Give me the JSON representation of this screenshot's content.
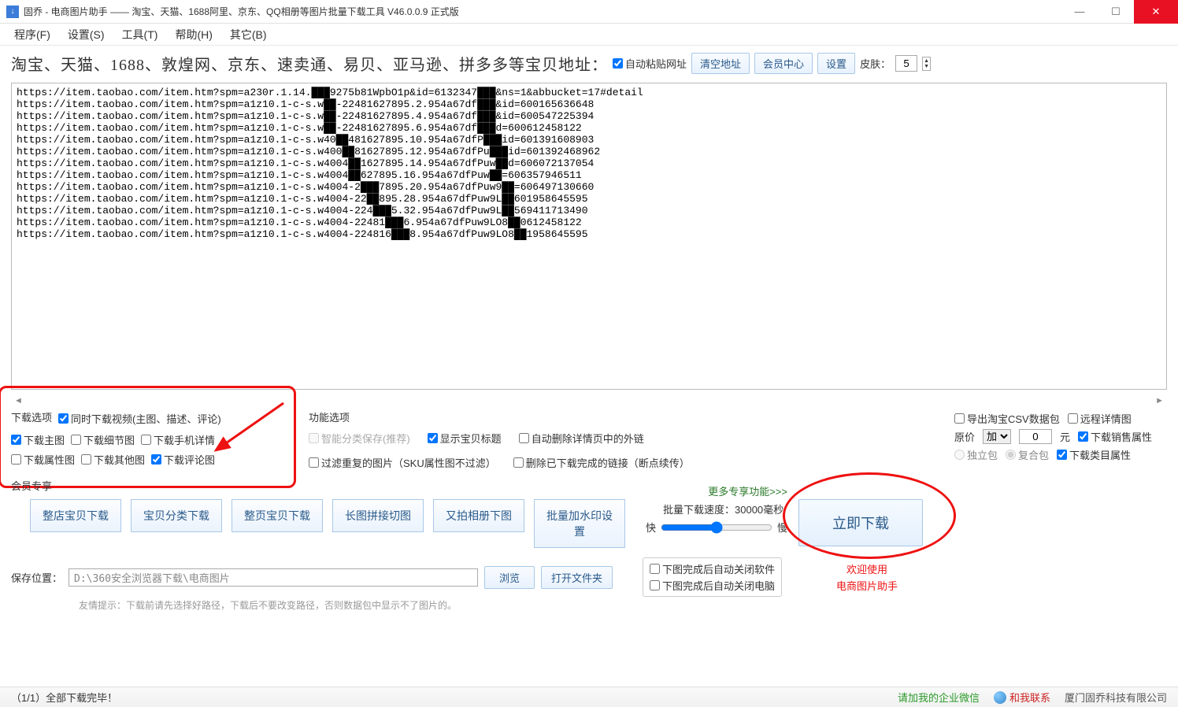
{
  "title": "固乔 - 电商图片助手 —— 淘宝、天猫、1688阿里、京东、QQ相册等图片批量下载工具 V46.0.0.9 正式版",
  "menu": {
    "program": "程序(F)",
    "settings": "设置(S)",
    "tools": "工具(T)",
    "help": "帮助(H)",
    "other": "其它(B)"
  },
  "topbar": {
    "label": "淘宝、天猫、1688、敦煌网、京东、速卖通、易贝、亚马逊、拼多多等宝贝地址：",
    "auto_paste": "自动粘贴网址",
    "clear": "清空地址",
    "member": "会员中心",
    "setting": "设置",
    "skin": "皮肤：",
    "skin_val": "5"
  },
  "urls": "https://item.taobao.com/item.htm?spm=a230r.1.14.███9275b81WpbO1p&id=6132347███&ns=1&abbucket=17#detail\nhttps://item.taobao.com/item.htm?spm=a1z10.1-c-s.w██-22481627895.2.954a67df███&id=600165636648\nhttps://item.taobao.com/item.htm?spm=a1z10.1-c-s.w██-22481627895.4.954a67df███&id=600547225394\nhttps://item.taobao.com/item.htm?spm=a1z10.1-c-s.w██-22481627895.6.954a67df███d=600612458122\nhttps://item.taobao.com/item.htm?spm=a1z10.1-c-s.w40██481627895.10.954a67dfP███id=601391608903\nhttps://item.taobao.com/item.htm?spm=a1z10.1-c-s.w400██81627895.12.954a67dfPu███id=601392468962\nhttps://item.taobao.com/item.htm?spm=a1z10.1-c-s.w4004██1627895.14.954a67dfPuw██d=606072137054\nhttps://item.taobao.com/item.htm?spm=a1z10.1-c-s.w4004██627895.16.954a67dfPuw██=606357946511\nhttps://item.taobao.com/item.htm?spm=a1z10.1-c-s.w4004-2███7895.20.954a67dfPuw9██=606497130660\nhttps://item.taobao.com/item.htm?spm=a1z10.1-c-s.w4004-22██895.28.954a67dfPuw9L██601958645595\nhttps://item.taobao.com/item.htm?spm=a1z10.1-c-s.w4004-224███5.32.954a67dfPuw9L██569411713490\nhttps://item.taobao.com/item.htm?spm=a1z10.1-c-s.w4004-22481███6.954a67dfPuw9LO8██0612458122\nhttps://item.taobao.com/item.htm?spm=a1z10.1-c-s.w4004-224816███8.954a67dfPuw9LO8██1958645595",
  "dl_opts": {
    "title": "下载选项",
    "video": "同时下载视频(主图、描述、评论)",
    "main": "下载主图",
    "detail": "下载细节图",
    "mobile": "下载手机详情",
    "attr": "下载属性图",
    "other": "下载其他图",
    "review": "下载评论图"
  },
  "func": {
    "title": "功能选项",
    "smart": "智能分类保存(推荐)",
    "show_title": "显示宝贝标题",
    "auto_del": "自动删除详情页中的外链",
    "filter_dup": "过滤重复的图片（SKU属性图不过滤）",
    "del_done": "删除已下载完成的链接（断点续传）"
  },
  "right": {
    "export_csv": "导出淘宝CSV数据包",
    "remote": "远程详情图",
    "orig": "原价",
    "orig_sel": "加",
    "orig_val": "0",
    "yuan": "元",
    "dl_sale": "下载销售属性",
    "radio_single": "独立包",
    "radio_combo": "复合包",
    "dl_cat": "下载类目属性"
  },
  "member": {
    "title": "会员专享",
    "b1": "整店宝贝下载",
    "b2": "宝贝分类下载",
    "b3": "整页宝贝下载",
    "b4": "长图拼接切图",
    "b5": "又拍相册下图",
    "b6": "批量加水印设置",
    "more": "更多专享功能>>>"
  },
  "speed": {
    "label": "批量下载速度：30000毫秒",
    "fast": "快",
    "slow": "慢"
  },
  "download_now": "立即下载",
  "close_opts": {
    "soft": "下图完成后自动关闭软件",
    "pc": "下图完成后自动关闭电脑"
  },
  "welcome": {
    "l1": "欢迎使用",
    "l2": "电商图片助手"
  },
  "save": {
    "label": "保存位置：",
    "path": "D:\\360安全浏览器下载\\电商图片",
    "browse": "浏览",
    "open": "打开文件夹"
  },
  "hint": "友情提示：下载前请先选择好路径，下载后不要改变路径，否则数据包中显示不了图片的。",
  "status": {
    "progress": "（1/1）全部下载完毕！",
    "wechat": "请加我的企业微信",
    "contact": "和我联系",
    "company": "厦门固乔科技有限公司"
  }
}
